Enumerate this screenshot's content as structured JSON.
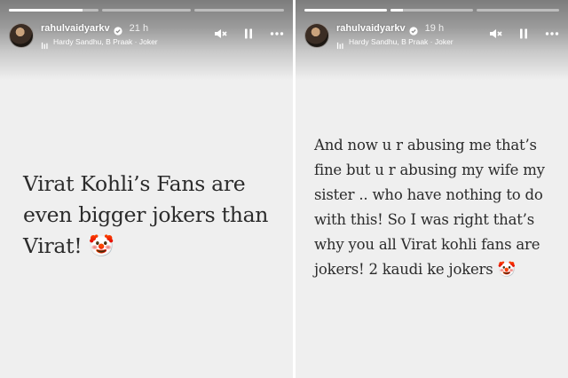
{
  "stories": [
    {
      "username": "rahulvaidyarkv",
      "time": "21 h",
      "music": "Hardy Sandhu, B Praak · Joker",
      "progress": {
        "segments": 3,
        "completed": 0,
        "current_fraction": 0.82
      },
      "icons": {
        "mute": "muted-speaker-icon",
        "pause": "pause-icon",
        "more": "more-options-icon",
        "verified": "verified-badge-icon",
        "music": "music-note-icon"
      },
      "caption": "Virat Kohli’s Fans are even bigger jokers than Virat!",
      "emoji": "🤡"
    },
    {
      "username": "rahulvaidyarkv",
      "time": "19 h",
      "music": "Hardy Sandhu, B Praak · Joker",
      "progress": {
        "segments": 3,
        "completed": 1,
        "current_fraction": 0.15
      },
      "icons": {
        "mute": "muted-speaker-icon",
        "pause": "pause-icon",
        "more": "more-options-icon",
        "verified": "verified-badge-icon",
        "music": "music-note-icon"
      },
      "caption": "And now u r abusing me that’s fine but u r abusing my wife my sister .. who have nothing to do with this! So I was right that’s why you all Virat kohli fans are jokers! 2 kaudi ke jokers",
      "emoji": "🤡"
    }
  ]
}
